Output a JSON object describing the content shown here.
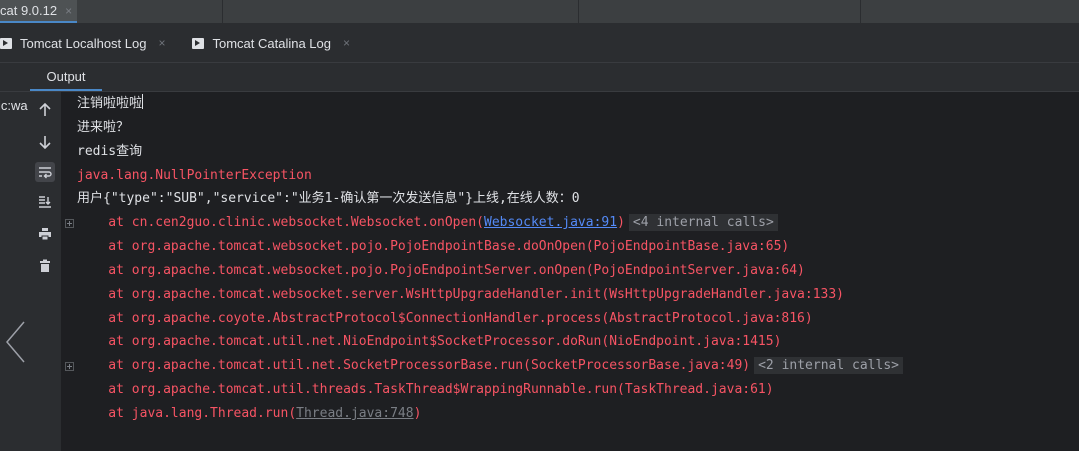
{
  "run_tab": {
    "label": "cat 9.0.12",
    "close": "×"
  },
  "log_tabs": [
    {
      "label": "Tomcat Localhost Log",
      "close": "×"
    },
    {
      "label": "Tomcat Catalina Log",
      "close": "×"
    }
  ],
  "left_cut_tab": "t",
  "output_tab": "Output",
  "tree_cut_text": "ic:wa",
  "toolbar_icons": [
    "arrow-up-icon",
    "arrow-down-icon",
    "soft-wrap-icon",
    "scroll-to-end-icon",
    "print-icon",
    "trash-icon"
  ],
  "console": {
    "line1": "注销啦啦啦",
    "line2": "进来啦？",
    "line3": "redis查询",
    "exception": "java.lang.NullPointerException",
    "online": "用户{\"type\":\"SUB\",\"service\":\"业务1-确认第一次发送信息\"}上线,在线人数：0",
    "trace": [
      {
        "pre": "    at cn.cen2guo.clinic.websocket.Websocket.onOpen(",
        "link": "Websocket.java:91",
        "post": ")",
        "internal": "<4 internal calls>",
        "fold": true
      },
      {
        "text": "    at org.apache.tomcat.websocket.pojo.PojoEndpointBase.doOnOpen(PojoEndpointBase.java:65)"
      },
      {
        "text": "    at org.apache.tomcat.websocket.pojo.PojoEndpointServer.onOpen(PojoEndpointServer.java:64)"
      },
      {
        "text": "    at org.apache.tomcat.websocket.server.WsHttpUpgradeHandler.init(WsHttpUpgradeHandler.java:133)"
      },
      {
        "text": "    at org.apache.coyote.AbstractProtocol$ConnectionHandler.process(AbstractProtocol.java:816)"
      },
      {
        "text": "    at org.apache.tomcat.util.net.NioEndpoint$SocketProcessor.doRun(NioEndpoint.java:1415)"
      },
      {
        "text": "    at org.apache.tomcat.util.net.SocketProcessorBase.run(SocketProcessorBase.java:49)",
        "internal": "<2 internal calls>",
        "fold": true
      },
      {
        "text": "    at org.apache.tomcat.util.threads.TaskThread$WrappingRunnable.run(TaskThread.java:61)"
      },
      {
        "pre": "    at java.lang.Thread.run(",
        "link_grey": "Thread.java:748",
        "post": ")"
      }
    ]
  },
  "colors": {
    "error": "#f75464",
    "link": "#548af7",
    "accent": "#4a88c7",
    "console_bg": "#1e1f22"
  }
}
